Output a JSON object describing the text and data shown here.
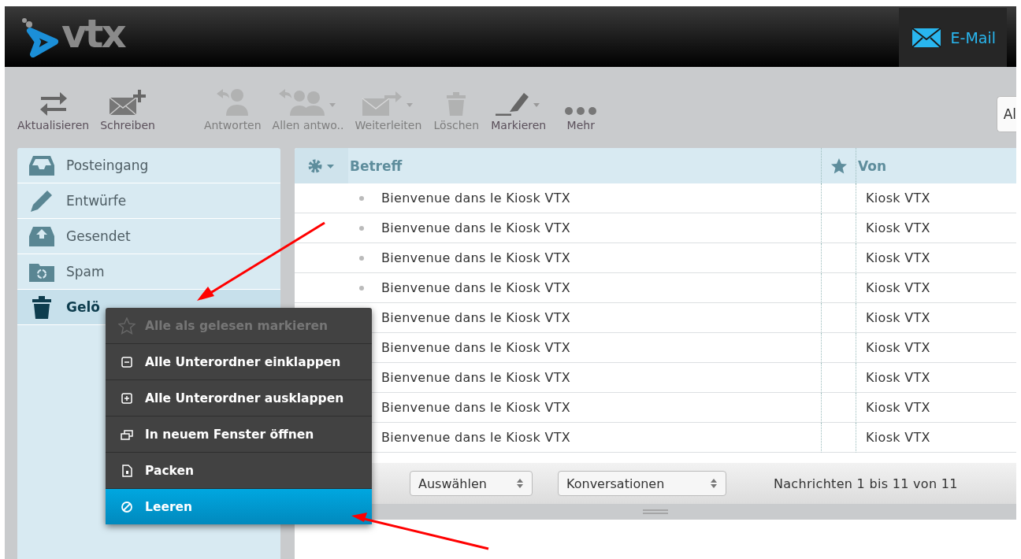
{
  "header": {
    "logo": "vtx",
    "apps": [
      {
        "label": "E-Mail",
        "selected": true
      }
    ]
  },
  "toolbar": {
    "groups": [
      [
        {
          "label": "Aktualisieren",
          "disabled": false,
          "dropdown": false
        },
        {
          "label": "Schreiben",
          "disabled": false,
          "dropdown": false
        }
      ],
      [
        {
          "label": "Antworten",
          "disabled": true,
          "dropdown": false
        },
        {
          "label": "Allen antwo..",
          "disabled": true,
          "dropdown": true
        },
        {
          "label": "Weiterleiten",
          "disabled": true,
          "dropdown": true
        },
        {
          "label": "Löschen",
          "disabled": true,
          "dropdown": false
        },
        {
          "label": "Markieren",
          "disabled": false,
          "dropdown": true
        },
        {
          "label": "Mehr",
          "disabled": false,
          "dropdown": false
        }
      ]
    ],
    "edge_button": "Al"
  },
  "folders": [
    {
      "label": "Posteingang",
      "selected": false
    },
    {
      "label": "Entwürfe",
      "selected": false
    },
    {
      "label": "Gesendet",
      "selected": false
    },
    {
      "label": "Spam",
      "selected": false
    },
    {
      "label": "Gelö",
      "selected": true
    }
  ],
  "mail_list": {
    "columns": [
      {
        "label": "Betreff",
        "kind": "subject"
      },
      {
        "kind": "star"
      },
      {
        "label": "Von",
        "kind": "from"
      }
    ],
    "rows": [
      {
        "subject": "Bienvenue dans le Kiosk VTX",
        "from": "Kiosk VTX"
      },
      {
        "subject": "Bienvenue dans le Kiosk VTX",
        "from": "Kiosk VTX"
      },
      {
        "subject": "Bienvenue dans le Kiosk VTX",
        "from": "Kiosk VTX"
      },
      {
        "subject": "Bienvenue dans le Kiosk VTX",
        "from": "Kiosk VTX"
      },
      {
        "subject": "Bienvenue dans le Kiosk VTX",
        "from": "Kiosk VTX"
      },
      {
        "subject": "Bienvenue dans le Kiosk VTX",
        "from": "Kiosk VTX"
      },
      {
        "subject": "Bienvenue dans le Kiosk VTX",
        "from": "Kiosk VTX"
      },
      {
        "subject": "Bienvenue dans le Kiosk VTX",
        "from": "Kiosk VTX"
      },
      {
        "subject": "Bienvenue dans le Kiosk VTX",
        "from": "Kiosk VTX"
      }
    ],
    "footer": {
      "select": "Auswählen",
      "view": "Konversationen",
      "count": "Nachrichten 1 bis 11 von 11"
    }
  },
  "context_menu": {
    "items": [
      {
        "label": "Alle als gelesen markieren",
        "disabled": true,
        "selected": false
      },
      {
        "label": "Alle Unterordner einklappen",
        "disabled": false,
        "selected": false
      },
      {
        "label": "Alle Unterordner ausklappen",
        "disabled": false,
        "selected": false
      },
      {
        "label": "In neuem Fenster öffnen",
        "disabled": false,
        "selected": false
      },
      {
        "label": "Packen",
        "disabled": false,
        "selected": false
      },
      {
        "label": "Leeren",
        "disabled": false,
        "selected": true
      }
    ]
  }
}
